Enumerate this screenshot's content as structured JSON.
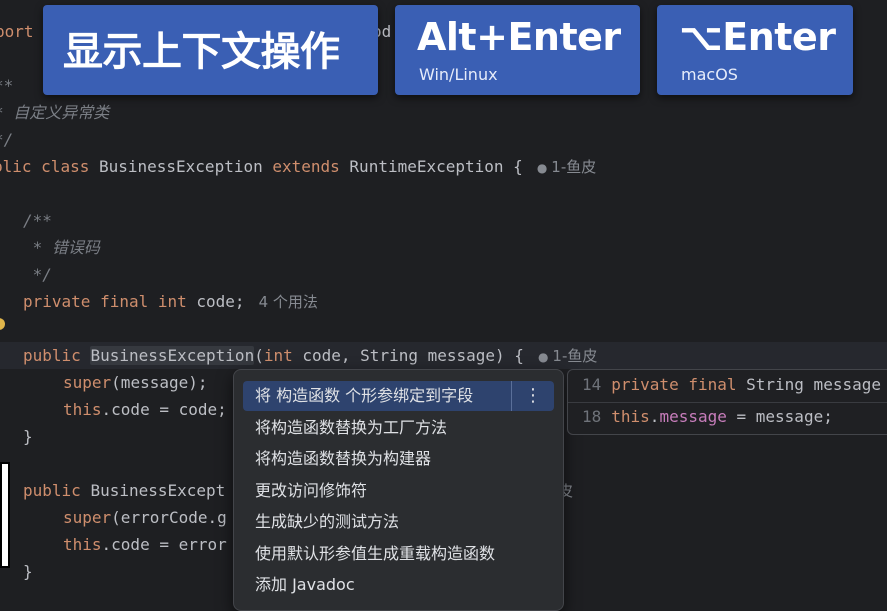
{
  "banners": {
    "show_context_actions": "显示上下文操作",
    "alt_enter": "Alt+Enter",
    "alt_enter_platform": "Win/Linux",
    "mac_keys": "⌥Enter",
    "mac_platform": "macOS"
  },
  "code": {
    "l0_a": "port",
    "l0_b": "od",
    "l1": "**",
    "l2_star": "* ",
    "l2_text": "自定义异常类",
    "l3": "*/",
    "l4_public": "blic ",
    "l4_class": "class ",
    "l4_name": "BusinessException ",
    "l4_extends": "extends ",
    "l4_super": "RuntimeException {",
    "l4_hint": "1-鱼皮",
    "l6": "/**",
    "l7_star": " * ",
    "l7_text": "错误码",
    "l8": " */",
    "l9_private": "private ",
    "l9_final": "final ",
    "l9_int": "int ",
    "l9_code": "code;",
    "l9_hint": "4 个用法",
    "l11_public": "public ",
    "l11_ctor": "BusinessException",
    "l11_open": "(",
    "l11_int": "int ",
    "l11_rest": "code, String message) {",
    "l11_hint": "1-鱼皮",
    "l12_super": "super",
    "l12_rest": "(message);",
    "l13_this": "this",
    "l13_rest": ".code = code;",
    "l14": "}",
    "l16_public": "public ",
    "l16_rest": "BusinessExcept",
    "l16_hint": "皮",
    "l17_super": "super",
    "l17_rest": "(errorCode.g",
    "l18_this": "this",
    "l18_rest": ".code = error",
    "l19": "}"
  },
  "context_menu": {
    "items": [
      "将 构造函数 个形参绑定到字段",
      "将构造函数替换为工厂方法",
      "将构造函数替换为构建器",
      "更改访问修饰符",
      "生成缺少的测试方法",
      "使用默认形参值生成重载构造函数",
      "添加 Javadoc"
    ],
    "more_icon": "⋮"
  },
  "preview": {
    "line1_num": "14",
    "line1_private": "private ",
    "line1_final": "final ",
    "line1_rest": "String message",
    "line2_num": "18",
    "line2_this": "this",
    "line2_dot": ".",
    "line2_field": "message",
    "line2_rest": " = message;"
  },
  "colors": {
    "background": "#1e1f22",
    "keyword": "#cf8e6d",
    "comment": "#7a7e85",
    "banner": "#3a5fb4",
    "menu_selected": "#2e436e"
  }
}
